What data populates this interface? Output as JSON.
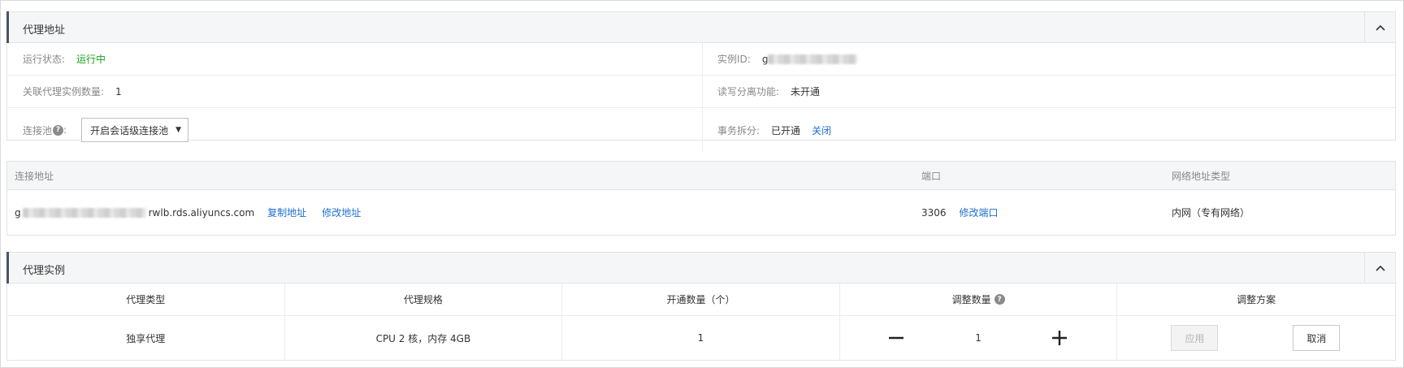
{
  "proxy_address": {
    "title": "代理地址",
    "status_label": "运行状态:",
    "status_value": "运行中",
    "instance_id_label": "实例ID:",
    "instance_id_prefix": "g",
    "linked_count_label": "关联代理实例数量:",
    "linked_count_value": "1",
    "rw_split_label": "读写分离功能:",
    "rw_split_value": "未开通",
    "pool_label": "连接池",
    "pool_help": "?",
    "pool_suffix": ":",
    "pool_select_value": "开启会话级连接池",
    "txn_split_label": "事务拆分:",
    "txn_split_value": "已开通",
    "txn_split_action": "关闭"
  },
  "connection_table": {
    "headers": [
      "连接地址",
      "端口",
      "网络地址类型"
    ],
    "row": {
      "address_prefix": "g",
      "address_suffix": "rwlb.rds.aliyuncs.com",
      "copy_link": "复制地址",
      "edit_link": "修改地址",
      "port": "3306",
      "edit_port_link": "修改端口",
      "network_type": "内网（专有网络）"
    }
  },
  "proxy_instance": {
    "title": "代理实例",
    "headers": [
      "代理类型",
      "代理规格",
      "开通数量（个）",
      "调整数量",
      "调整方案"
    ],
    "row": {
      "type": "独享代理",
      "spec": "CPU 2 核，内存 4GB",
      "count": "1",
      "adjust_value": "1",
      "apply_button": "应用",
      "cancel_button": "取消"
    }
  },
  "colors": {
    "accent_bar": "#4a5563",
    "link": "#1e6fd0",
    "running": "#1aa31a"
  }
}
